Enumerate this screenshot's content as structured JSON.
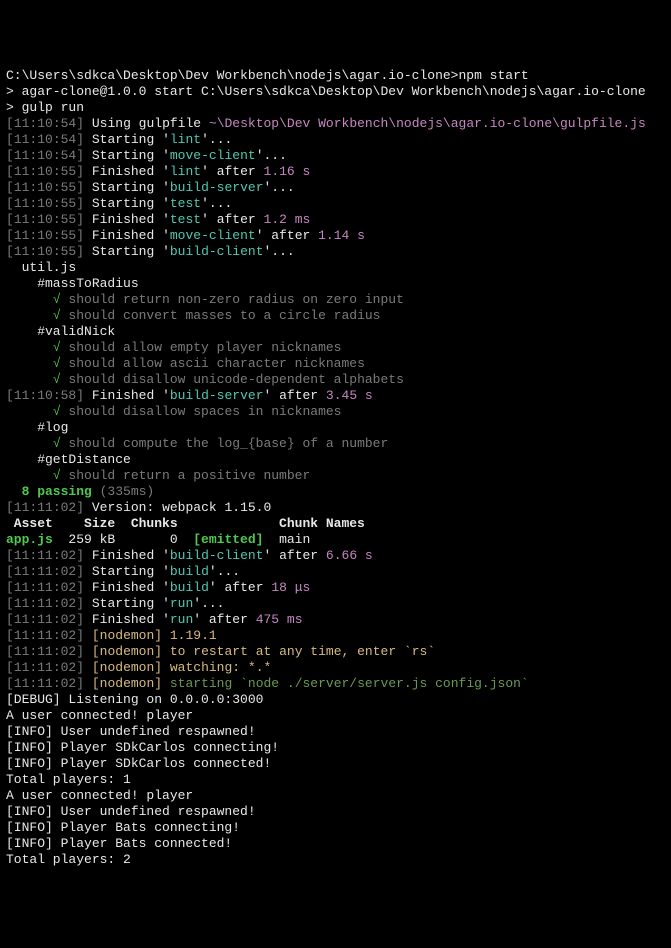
{
  "prompt": "C:\\Users\\sdkca\\Desktop\\Dev Workbench\\nodejs\\agar.io-clone>npm start",
  "startLine": {
    "prefix": "> agar-clone@1.0.0 start ",
    "path": "C:\\Users\\sdkca\\Desktop\\Dev Workbench\\nodejs\\agar.io-clone"
  },
  "gulpRun": "> gulp run",
  "ts": {
    "t54": "11:10:54",
    "t55": "11:10:55",
    "t58": "11:10:58",
    "t02": "11:11:02"
  },
  "gulpfileLabel": "Using gulpfile ",
  "gulpfilePath": "~\\Desktop\\Dev Workbench\\nodejs\\agar.io-clone\\gulpfile.js",
  "starting": "Starting '",
  "finished": "Finished '",
  "afterSuffix": "'...",
  "afterWord": "' after ",
  "tasks": {
    "lint": "lint",
    "moveClient": "move-client",
    "buildServer": "build-server",
    "test": "test",
    "buildClient": "build-client",
    "build": "build",
    "run": "run"
  },
  "durations": {
    "lint": "1.16 s",
    "test": "1.2 ms",
    "moveClient": "1.14 s",
    "buildServer": "3.45 s",
    "buildClient": "6.66 s",
    "build": "18 μs",
    "run": "475 ms"
  },
  "mocha": {
    "file": "  util.js",
    "massToRadius": "    #massToRadius",
    "m1": "should return non-zero radius on zero input",
    "m2": "should convert masses to a circle radius",
    "validNick": "    #validNick",
    "v1": "should allow empty player nicknames",
    "v2": "should allow ascii character nicknames",
    "v3": "should disallow unicode-dependent alphabets",
    "v4": "should disallow spaces in nicknames",
    "log": "    #log",
    "l1": "should compute the log_{base} of a number",
    "getDist": "    #getDistance",
    "d1": "should return a positive number",
    "check": "√ ",
    "passing": "  8 passing",
    "passingTime": " (335ms)"
  },
  "webpackVersion": "Version: webpack 1.15.0",
  "webpackHeader": " Asset    Size  Chunks             Chunk Names",
  "webpackAsset": "app.js",
  "webpackRow": "  259 kB       0  ",
  "emitted": "[emitted]",
  "webpackMain": "  main",
  "nodemon": {
    "tag": "[nodemon]",
    "ver": " 1.19.1",
    "restart": " to restart at any time, enter `rs`",
    "watch": " watching: *.*",
    "start": " starting `node ./server/server.js config.json`"
  },
  "logs": [
    "[DEBUG] Listening on 0.0.0.0:3000",
    "A user connected! player",
    "[INFO] User undefined respawned!",
    "[INFO] Player SDkCarlos connecting!",
    "[INFO] Player SDkCarlos connected!",
    "Total players: 1",
    "A user connected! player",
    "[INFO] User undefined respawned!",
    "[INFO] Player Bats connecting!",
    "[INFO] Player Bats connected!",
    "Total players: 2"
  ]
}
